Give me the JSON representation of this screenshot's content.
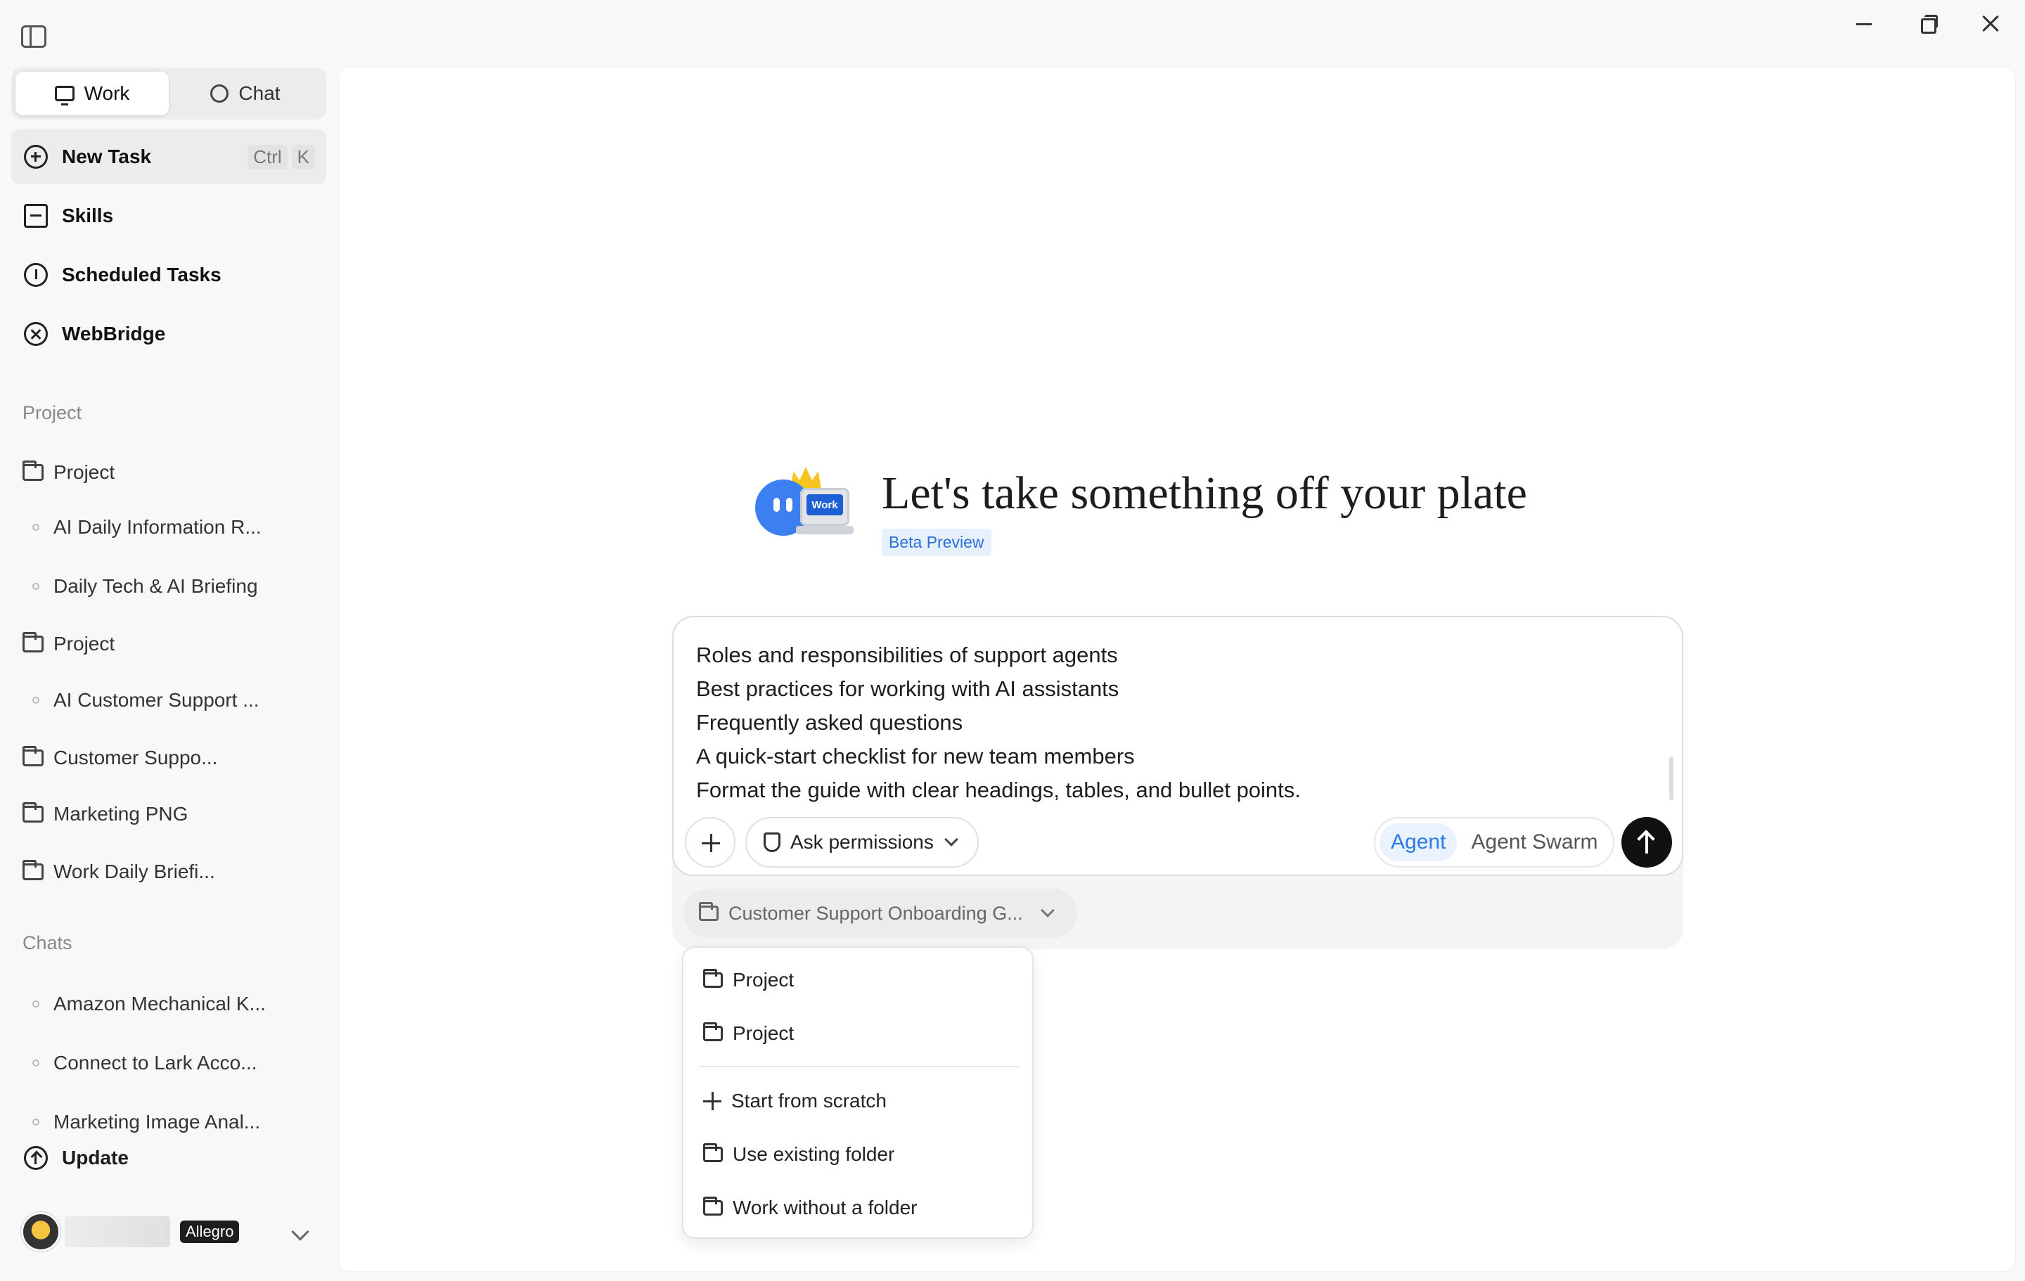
{
  "window": {
    "controls": [
      "minimize",
      "restore",
      "close"
    ]
  },
  "sidebar": {
    "modes": [
      {
        "label": "Work",
        "icon": "monitor-icon",
        "active": true
      },
      {
        "label": "Chat",
        "icon": "chat-bubble-icon",
        "active": false
      }
    ],
    "nav": [
      {
        "label": "New Task",
        "icon": "plus-circle-icon",
        "shortcut": [
          "Ctrl",
          "K"
        ],
        "active": true
      },
      {
        "label": "Skills",
        "icon": "skills-book-icon"
      },
      {
        "label": "Scheduled Tasks",
        "icon": "alarm-clock-icon"
      },
      {
        "label": "WebBridge",
        "icon": "webbridge-icon"
      }
    ],
    "project_section": "Project",
    "projects": [
      {
        "label": "Project",
        "type": "folder"
      },
      {
        "label": "AI Daily Information R...",
        "type": "task"
      },
      {
        "label": "Daily Tech & AI Briefing",
        "type": "task"
      },
      {
        "label": "Project",
        "type": "folder"
      },
      {
        "label": "AI Customer Support ...",
        "type": "task"
      },
      {
        "label": "Customer Suppo...",
        "type": "folder"
      },
      {
        "label": "Marketing PNG",
        "type": "folder"
      },
      {
        "label": "Work Daily Briefi...",
        "type": "folder"
      }
    ],
    "chats_section": "Chats",
    "chats": [
      {
        "label": "Amazon Mechanical K..."
      },
      {
        "label": "Connect to Lark Acco..."
      },
      {
        "label": "Marketing Image Anal..."
      }
    ],
    "update_label": "Update",
    "user": {
      "plan": "Allegro"
    }
  },
  "main": {
    "headline": "Let's take something off your plate",
    "badge": "Beta Preview",
    "mascot_screen_text": "Work",
    "composer": {
      "lines": [
        "Roles and responsibilities of support agents",
        "Best practices for working with AI assistants",
        "Frequently asked questions",
        "A quick-start checklist for new team members",
        "Format the guide with clear headings, tables, and bullet points."
      ],
      "permission_label": "Ask permissions",
      "modes": [
        {
          "label": "Agent",
          "active": true
        },
        {
          "label": "Agent Swarm",
          "active": false
        }
      ]
    },
    "folder_select": {
      "value": "Customer Support Onboarding G..."
    },
    "dropdown": {
      "items": [
        {
          "label": "Project",
          "icon": "folder-icon"
        },
        {
          "label": "Project",
          "icon": "folder-icon"
        },
        {
          "label": "Start from scratch",
          "icon": "plus-icon"
        },
        {
          "label": "Use existing folder",
          "icon": "folder-plus-icon"
        },
        {
          "label": "Work without a folder",
          "icon": "folder-x-icon"
        }
      ]
    }
  },
  "colors": {
    "accent": "#2a7ae2",
    "send": "#111111",
    "active_bg": "#ececee"
  }
}
